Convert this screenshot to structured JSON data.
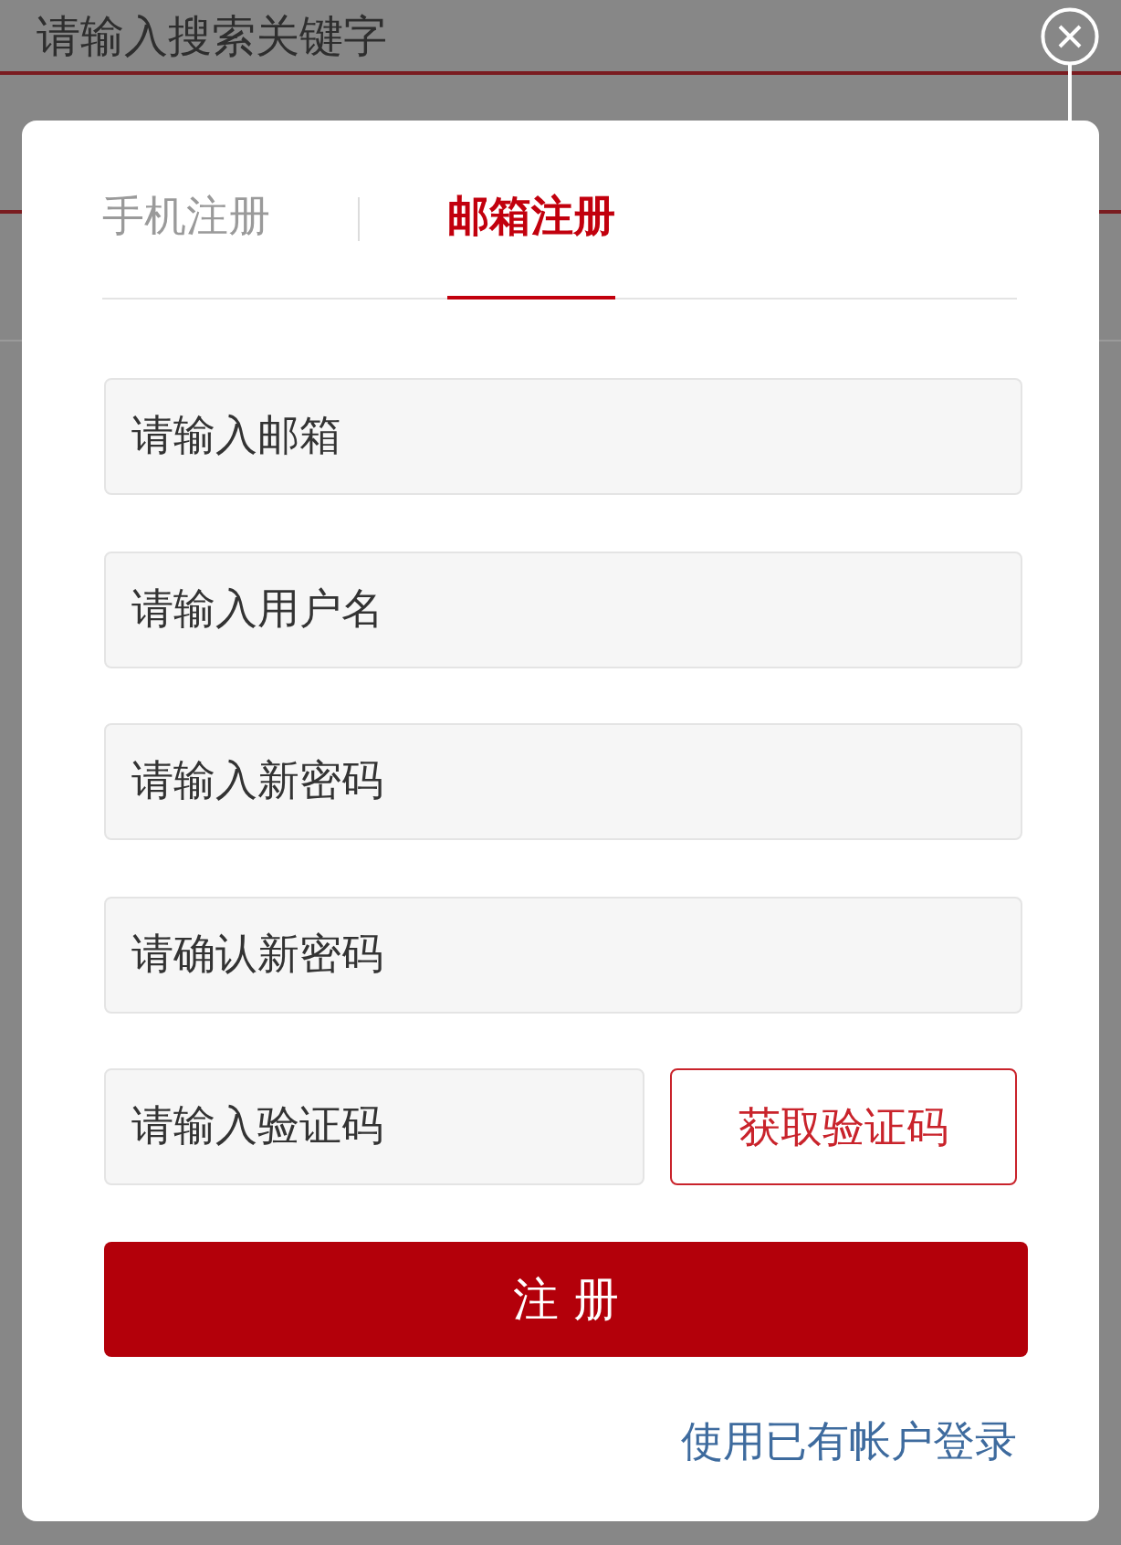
{
  "background_page": {
    "search": {
      "placeholder": "请输入搜索关键字"
    }
  },
  "dialog": {
    "tabs": [
      {
        "label": "手机注册",
        "selected": false
      },
      {
        "label": "邮箱注册",
        "selected": true
      }
    ],
    "fields": [
      {
        "placeholder": "请输入邮箱"
      },
      {
        "placeholder": "请输入用户名"
      },
      {
        "placeholder": "请输入新密码"
      },
      {
        "placeholder": "请确认新密码"
      }
    ],
    "verification": {
      "placeholder": "请输入验证码",
      "button": "获取验证码"
    },
    "submit_button": "注 册",
    "login_link": "使用已有帐户登录"
  }
}
